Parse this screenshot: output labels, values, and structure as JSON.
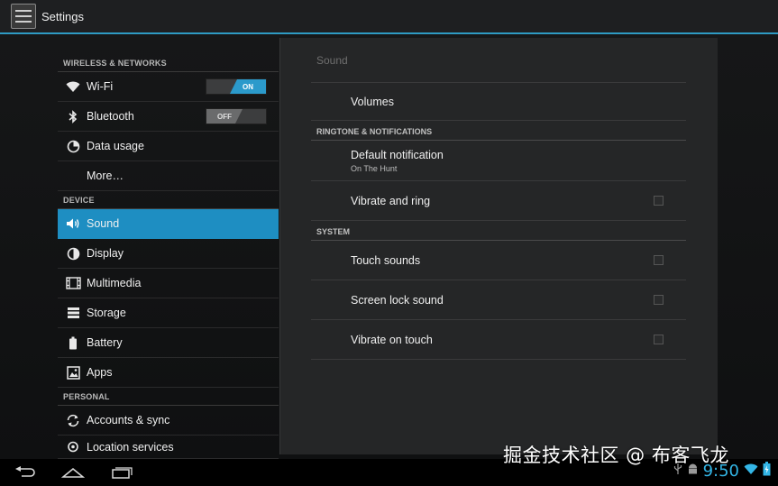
{
  "action_bar": {
    "title": "Settings",
    "icon": "settings-sliders-icon"
  },
  "sidebar": {
    "sections": [
      {
        "header": "WIRELESS & NETWORKS",
        "items": [
          {
            "label": "Wi-Fi",
            "icon": "wifi-icon",
            "toggle": "ON"
          },
          {
            "label": "Bluetooth",
            "icon": "bluetooth-icon",
            "toggle": "OFF"
          },
          {
            "label": "Data usage",
            "icon": "data-usage-icon"
          },
          {
            "label": "More…"
          }
        ]
      },
      {
        "header": "DEVICE",
        "items": [
          {
            "label": "Sound",
            "icon": "sound-icon",
            "selected": true
          },
          {
            "label": "Display",
            "icon": "display-icon"
          },
          {
            "label": "Multimedia",
            "icon": "multimedia-icon"
          },
          {
            "label": "Storage",
            "icon": "storage-icon"
          },
          {
            "label": "Battery",
            "icon": "battery-icon"
          },
          {
            "label": "Apps",
            "icon": "apps-icon"
          }
        ]
      },
      {
        "header": "PERSONAL",
        "items": [
          {
            "label": "Accounts & sync",
            "icon": "sync-icon"
          },
          {
            "label": "Location services",
            "icon": "location-icon"
          }
        ]
      }
    ]
  },
  "detail": {
    "title": "Sound",
    "volumes_label": "Volumes",
    "ringtone_header": "RINGTONE & NOTIFICATIONS",
    "default_notification": {
      "title": "Default notification",
      "summary": "On The Hunt"
    },
    "vibrate_and_ring": {
      "title": "Vibrate and ring",
      "checked": false
    },
    "system_header": "SYSTEM",
    "touch_sounds": {
      "title": "Touch sounds",
      "checked": false
    },
    "screen_lock_sound": {
      "title": "Screen lock sound",
      "checked": false
    },
    "vibrate_on_touch": {
      "title": "Vibrate on touch",
      "checked": false
    }
  },
  "nav_bar": {
    "back": "back-icon",
    "home": "home-icon",
    "recents": "recent-apps-icon"
  },
  "status": {
    "time": "9:50",
    "icons": [
      "usb-icon",
      "android-debug-icon",
      "wifi-signal-icon",
      "battery-charging-icon"
    ]
  },
  "watermark": "掘金技术社区 @ 布客飞龙",
  "colors": {
    "accent": "#33b5e5",
    "selected": "#1e8ec2",
    "action_bar": "#1e1f21",
    "panel": "#252627"
  }
}
